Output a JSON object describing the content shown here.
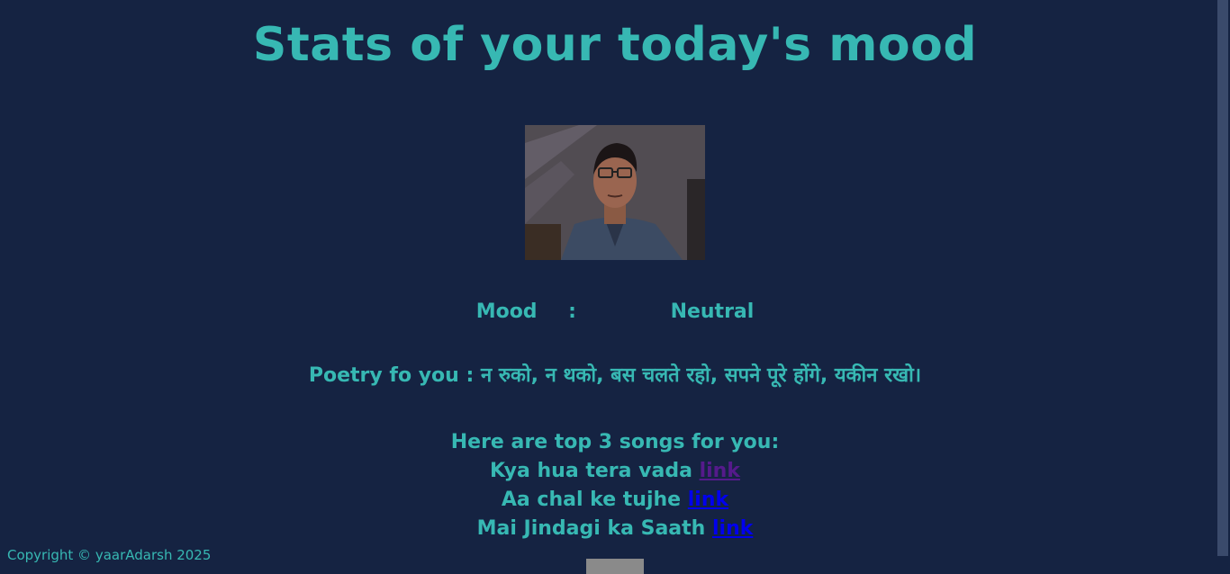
{
  "page": {
    "title": "Stats of your today's mood"
  },
  "mood": {
    "label": "Mood",
    "separator": ":",
    "value": "Neutral"
  },
  "poetry": {
    "label": "Poetry fo you :",
    "text": "न रुको, न थको, बस चलते रहो, सपने पूरे होंगे, यकीन रखो।"
  },
  "songs": {
    "heading": "Here are top 3 songs for you:",
    "items": [
      {
        "title": "Kya hua tera vada",
        "link_text": "link",
        "visited": true
      },
      {
        "title": "Aa chal ke tujhe",
        "link_text": "link",
        "visited": false
      },
      {
        "title": "Mai Jindagi ka Saath",
        "link_text": "link",
        "visited": false
      }
    ]
  },
  "footer": {
    "copyright": "Copyright © yaarAdarsh 2025"
  },
  "colors": {
    "background": "#152342",
    "accent": "#37b8b3",
    "link_visited": "#551a8b",
    "link": "#0000ee"
  },
  "icons": {
    "photo": "webcam-capture-photo"
  }
}
